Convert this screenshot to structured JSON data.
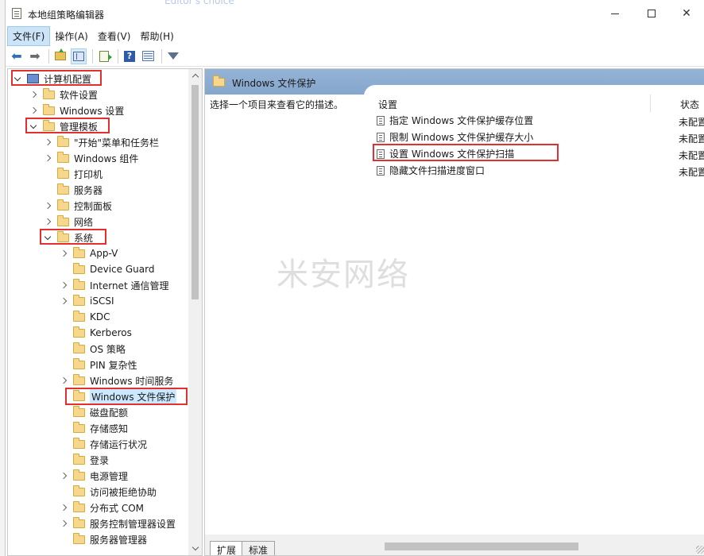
{
  "window": {
    "title": "本地组策略编辑器",
    "background_title": "Editor's choice"
  },
  "menubar": [
    "文件(F)",
    "操作(A)",
    "查看(V)",
    "帮助(H)"
  ],
  "toolbar": [
    "back-icon",
    "forward-icon",
    "up-folder-icon",
    "show-tree-icon",
    "export-list-icon",
    "help-icon",
    "view-icon",
    "filter-icon"
  ],
  "tree": {
    "items": [
      {
        "label": "计算机配置",
        "expanded": true,
        "icon": "computer-icon"
      },
      {
        "label": "软件设置",
        "expanded": false,
        "icon": "folder-icon"
      },
      {
        "label": "Windows 设置",
        "expanded": false,
        "icon": "folder-icon"
      },
      {
        "label": "管理模板",
        "expanded": true,
        "icon": "folder-icon"
      },
      {
        "label": "\"开始\"菜单和任务栏",
        "expanded": false,
        "icon": "folder-icon"
      },
      {
        "label": "Windows 组件",
        "expanded": false,
        "icon": "folder-icon"
      },
      {
        "label": "打印机",
        "expanded": null,
        "icon": "folder-icon"
      },
      {
        "label": "服务器",
        "expanded": null,
        "icon": "folder-icon"
      },
      {
        "label": "控制面板",
        "expanded": false,
        "icon": "folder-icon"
      },
      {
        "label": "网络",
        "expanded": false,
        "icon": "folder-icon"
      },
      {
        "label": "系统",
        "expanded": true,
        "icon": "folder-icon"
      },
      {
        "label": "App-V",
        "expanded": false,
        "icon": "folder-icon"
      },
      {
        "label": "Device Guard",
        "expanded": null,
        "icon": "folder-icon"
      },
      {
        "label": "Internet 通信管理",
        "expanded": false,
        "icon": "folder-icon"
      },
      {
        "label": "iSCSI",
        "expanded": false,
        "icon": "folder-icon"
      },
      {
        "label": "KDC",
        "expanded": null,
        "icon": "folder-icon"
      },
      {
        "label": "Kerberos",
        "expanded": null,
        "icon": "folder-icon"
      },
      {
        "label": "OS 策略",
        "expanded": null,
        "icon": "folder-icon"
      },
      {
        "label": "PIN 复杂性",
        "expanded": null,
        "icon": "folder-icon"
      },
      {
        "label": "Windows 时间服务",
        "expanded": false,
        "icon": "folder-icon"
      },
      {
        "label": "Windows 文件保护",
        "expanded": null,
        "icon": "folder-icon",
        "selected": true
      },
      {
        "label": "磁盘配额",
        "expanded": null,
        "icon": "folder-icon"
      },
      {
        "label": "存储感知",
        "expanded": null,
        "icon": "folder-icon"
      },
      {
        "label": "存储运行状况",
        "expanded": null,
        "icon": "folder-icon"
      },
      {
        "label": "登录",
        "expanded": null,
        "icon": "folder-icon"
      },
      {
        "label": "电源管理",
        "expanded": false,
        "icon": "folder-icon"
      },
      {
        "label": "访问被拒绝协助",
        "expanded": null,
        "icon": "folder-icon"
      },
      {
        "label": "分布式 COM",
        "expanded": false,
        "icon": "folder-icon"
      },
      {
        "label": "服务控制管理器设置",
        "expanded": false,
        "icon": "folder-icon"
      },
      {
        "label": "服务器管理器",
        "expanded": null,
        "icon": "folder-icon"
      }
    ]
  },
  "right": {
    "header_title": "Windows 文件保护",
    "description": "选择一个项目来查看它的描述。",
    "col_setting": "设置",
    "col_state": "状态",
    "rows": [
      {
        "label": "指定 Windows 文件保护缓存位置",
        "state": "未配置"
      },
      {
        "label": "限制 Windows 文件保护缓存大小",
        "state": "未配置"
      },
      {
        "label": "设置 Windows 文件保护扫描",
        "state": "未配置"
      },
      {
        "label": "隐藏文件扫描进度窗口",
        "state": "未配置"
      }
    ],
    "tabs": [
      "扩展",
      "标准"
    ]
  },
  "watermark": "米安网络",
  "colors": {
    "highlight_box": "#e03030",
    "header_blue": "#8fb0d4",
    "selection": "#cce8ff"
  }
}
